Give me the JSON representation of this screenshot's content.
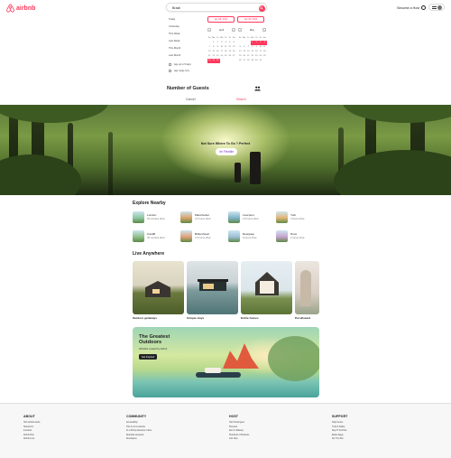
{
  "header": {
    "logo_text": "airbnb",
    "host_link": "Become a Host",
    "search_text": "Brazil"
  },
  "date_panel": {
    "options": [
      "Today",
      "Yesterday",
      "This Week",
      "Last Week",
      "This Month",
      "Last Month"
    ],
    "checkbox_1": "Age up to 5 days",
    "checkbox_2": "Age range only",
    "tab_start": "Apr 28, 2024",
    "tab_end": "Apr 28, 2024",
    "cal_left_month": "April",
    "cal_right_month": "May",
    "weekday_headers": [
      "Su",
      "Mo",
      "Tu",
      "We",
      "Th",
      "Fr",
      "Sa"
    ],
    "left_days": [
      "",
      "1",
      "2",
      "3",
      "4",
      "5",
      "6",
      "7",
      "8",
      "9",
      "10",
      "11",
      "12",
      "13",
      "14",
      "15",
      "16",
      "17",
      "18",
      "19",
      "20",
      "21",
      "22",
      "23",
      "24",
      "25",
      "26",
      "27",
      "28",
      "29",
      "30"
    ],
    "right_days": [
      "",
      "",
      "",
      "1",
      "2",
      "3",
      "4",
      "5",
      "6",
      "7",
      "8",
      "9",
      "10",
      "11",
      "12",
      "13",
      "14",
      "15",
      "16",
      "17",
      "18",
      "19",
      "20",
      "21",
      "22",
      "23",
      "24",
      "25",
      "26",
      "27",
      "28",
      "29",
      "30",
      "31"
    ]
  },
  "guests": {
    "title": "Number of Guests",
    "cancel": "Cancel",
    "search": "Search"
  },
  "hero": {
    "message": "Not Sure Where To Go ? Perfect",
    "button": "I'm Flexible"
  },
  "explore": {
    "title": "Explore Nearby",
    "items": [
      {
        "name": "London",
        "dist": "45 minutes drive"
      },
      {
        "name": "Manchester",
        "dist": "4.5 hours drive"
      },
      {
        "name": "Liverpool",
        "dist": "4.5 hours drive"
      },
      {
        "name": "York",
        "dist": "4 hours drive"
      },
      {
        "name": "Cardiff",
        "dist": "45 minutes drive"
      },
      {
        "name": "Birkenhead",
        "dist": "4.5 hours drive"
      },
      {
        "name": "Newquay",
        "dist": "6 hours drive"
      },
      {
        "name": "Hove",
        "dist": "2 hours drive"
      }
    ]
  },
  "live": {
    "title": "Live Anywhere",
    "cards": [
      {
        "label": "Outdoor getaways"
      },
      {
        "label": "Unique stays"
      },
      {
        "label": "Entire homes"
      },
      {
        "label": "Pet allowed"
      }
    ]
  },
  "banner": {
    "title": "The Greatest Outdoors",
    "subtitle": "Wishlists curated by Airbnb",
    "button": "Get Inspired"
  },
  "footer": {
    "columns": [
      {
        "title": "ABOUT",
        "links": [
          "How Airbnb works",
          "Newsroom",
          "Investors",
          "Airbnb Plus",
          "Airbnb Luxe"
        ]
      },
      {
        "title": "COMMUNITY",
        "links": [
          "Accessibility",
          "This is not a real site",
          "Its a Pretty Awesome Clone",
          "Referrals accepted",
          "Developers"
        ]
      },
      {
        "title": "HOST",
        "links": [
          "Vitor Domingues",
          "Presents",
          "Zero to Mastery",
          "Hundreds of Students",
          "Join Now"
        ]
      },
      {
        "title": "SUPPORT",
        "links": [
          "Help Centre",
          "Trust & Safety",
          "Say Hi YouTube",
          "Easter Eggs",
          "For The Win"
        ]
      }
    ]
  },
  "colors": {
    "brand": "#ff385c"
  }
}
